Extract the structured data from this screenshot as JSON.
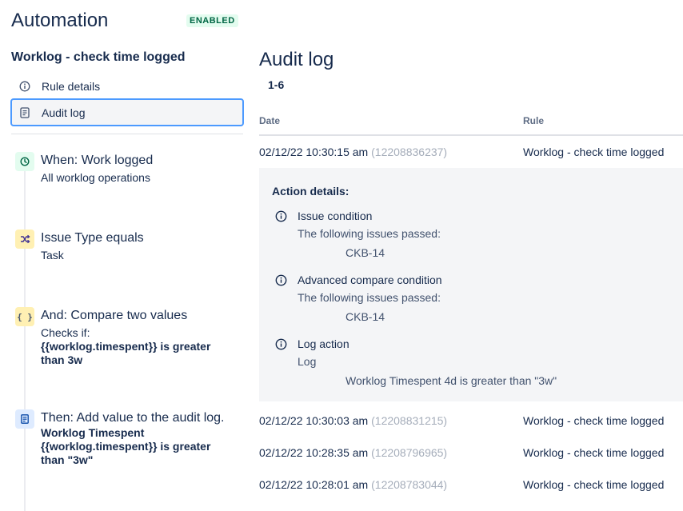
{
  "header": {
    "title": "Automation",
    "status": "ENABLED"
  },
  "sidebar": {
    "rule_name": "Worklog - check time logged",
    "nav": [
      {
        "label": "Rule details",
        "icon": "info-icon"
      },
      {
        "label": "Audit log",
        "icon": "document-icon"
      }
    ],
    "steps": [
      {
        "icon": "clock-icon",
        "title": "When: Work logged",
        "subtitle": "All worklog operations"
      },
      {
        "icon": "shuffle-icon",
        "title": "Issue Type equals",
        "subtitle": "Task"
      },
      {
        "icon": "braces-icon",
        "title": "And: Compare two values",
        "subtitle": "Checks if:",
        "detail": "{{worklog.timespent}} is greater than 3w"
      },
      {
        "icon": "log-icon",
        "title": "Then: Add value to the audit log.",
        "detail": "Worklog Timespent {{worklog.timespent}} is greater than \"3w\""
      }
    ]
  },
  "main": {
    "title": "Audit log",
    "range": "1-6",
    "columns": {
      "date": "Date",
      "rule": "Rule"
    },
    "rows": [
      {
        "date": "02/12/22 10:30:15 am",
        "id": "(12208836237)",
        "rule": "Worklog - check time logged"
      },
      {
        "date": "02/12/22 10:30:03 am",
        "id": "(12208831215)",
        "rule": "Worklog - check time logged"
      },
      {
        "date": "02/12/22 10:28:35 am",
        "id": "(12208796965)",
        "rule": "Worklog - check time logged"
      },
      {
        "date": "02/12/22 10:28:01 am",
        "id": "(12208783044)",
        "rule": "Worklog - check time logged"
      }
    ],
    "details": {
      "title": "Action details:",
      "actions": [
        {
          "title": "Issue condition",
          "subtitle": "The following issues passed:",
          "value": "CKB-14"
        },
        {
          "title": "Advanced compare condition",
          "subtitle": "The following issues passed:",
          "value": "CKB-14"
        },
        {
          "title": "Log action",
          "subtitle": "Log",
          "value": "Worklog Timespent 4d is greater than \"3w\""
        }
      ]
    }
  }
}
